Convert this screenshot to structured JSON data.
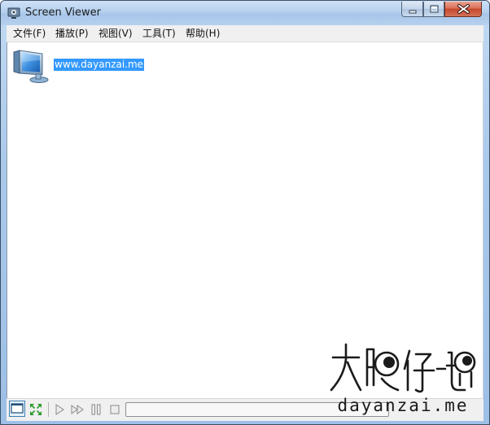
{
  "window": {
    "title": "Screen Viewer",
    "app_icon": "screen-viewer-icon",
    "controls": [
      "minimize-icon",
      "maximize-icon",
      "close-icon"
    ]
  },
  "menu": {
    "items": [
      {
        "label": "文件(F)"
      },
      {
        "label": "播放(P)"
      },
      {
        "label": "视图(V)"
      },
      {
        "label": "工具(T)"
      },
      {
        "label": "帮助(H)"
      }
    ]
  },
  "content": {
    "items": [
      {
        "icon": "computer-monitor-icon",
        "label": "www.dayanzai.me",
        "selected": true
      }
    ]
  },
  "toolbar": {
    "buttons": [
      {
        "icon": "window-view-icon",
        "active": true
      },
      {
        "icon": "fullscreen-icon"
      },
      {
        "icon": "play-icon"
      },
      {
        "icon": "fast-forward-icon"
      },
      {
        "icon": "pause-icon"
      },
      {
        "icon": "stop-icon"
      }
    ],
    "progress": 0
  },
  "watermark": {
    "text_cn": "大眼仔-旭",
    "text_en": "dayanzai.me"
  },
  "colors": {
    "selection": "#3399ff",
    "close_button": "#c7472a",
    "titlebar": "#b5d0ee"
  }
}
